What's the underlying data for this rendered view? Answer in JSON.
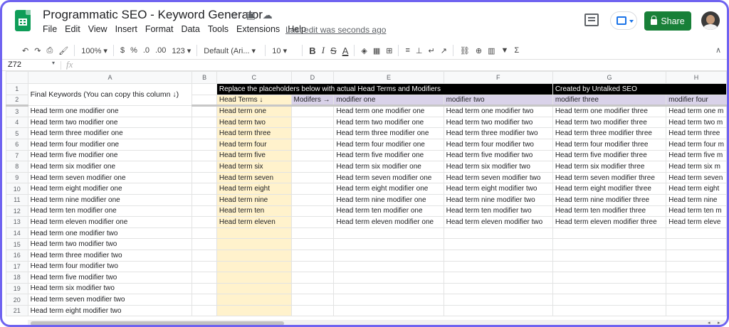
{
  "document": {
    "title": "Programmatic SEO - Keyword Generator",
    "star_icon": "☆",
    "folder_icon": "▣",
    "cloud_icon": "☁",
    "last_edit": "Last edit was seconds ago"
  },
  "menu": [
    "File",
    "Edit",
    "View",
    "Insert",
    "Format",
    "Data",
    "Tools",
    "Extensions",
    "Help"
  ],
  "header_actions": {
    "share_label": "Share",
    "share_color": "#188038",
    "present_color": "#1a73e8"
  },
  "toolbar": {
    "undo": "↶",
    "redo": "↷",
    "print": "⎙",
    "paint_format": "🖌",
    "zoom": "100%",
    "zoom_caret": "▾",
    "currency": "$",
    "percent": "%",
    "dec_decrease": ".0",
    "dec_increase": ".00",
    "more_formats": "123",
    "font": "Default (Ari...",
    "font_size": "10",
    "bold": "B",
    "italic": "I",
    "strike": "S",
    "text_color": "A",
    "fill": "◈",
    "borders": "▦",
    "merge": "⊞",
    "h_align": "≡",
    "v_align": "⊥",
    "wrap": "↵",
    "rotate": "↗",
    "link": "⛓",
    "comment": "⊕",
    "chart": "▥",
    "filter": "▼",
    "functions": "Σ",
    "collapse": "∧"
  },
  "formula_bar": {
    "name_box": "Z72",
    "fx": "fx",
    "value": ""
  },
  "columns": [
    "A",
    "B",
    "C",
    "D",
    "E",
    "F",
    "G",
    "H"
  ],
  "row1": {
    "a_merged": "Final Keywords (You can copy this column ↓)",
    "banner": "Replace the placeholders below with actual Head Terms and Modifiers",
    "credit": "Created by Untalked SEO"
  },
  "row2": {
    "head_terms": "Head Terms ↓",
    "modifiers": "Modifers →",
    "modifier_one": "modifier one",
    "modifier_two": "modifier two",
    "modifier_three": "modifier three",
    "modifier_four": "modifier four"
  },
  "rows": [
    {
      "n": "3",
      "a": "Head term one modifier one",
      "c": "Head term one",
      "e": "Head term one modifier one",
      "f": "Head term one modifier two",
      "g": "Head term one modifier three",
      "h": "Head term one m"
    },
    {
      "n": "4",
      "a": "Head term two modifier one",
      "c": "Head term two",
      "e": "Head term two modifier one",
      "f": "Head term two modifier two",
      "g": "Head term two modifier three",
      "h": "Head term two m"
    },
    {
      "n": "5",
      "a": "Head term three modifier one",
      "c": "Head term three",
      "e": "Head term three modifier one",
      "f": "Head term three modifier two",
      "g": "Head term three modifier three",
      "h": "Head term three"
    },
    {
      "n": "6",
      "a": "Head term four modifier one",
      "c": "Head term four",
      "e": "Head term four modifier one",
      "f": "Head term four modifier two",
      "g": "Head term four modifier three",
      "h": "Head term four m"
    },
    {
      "n": "7",
      "a": "Head term five modifier one",
      "c": "Head term five",
      "e": "Head term five modifier one",
      "f": "Head term five modifier two",
      "g": "Head term five modifier three",
      "h": "Head term five m"
    },
    {
      "n": "8",
      "a": "Head term six modifier one",
      "c": "Head term six",
      "e": "Head term six modifier one",
      "f": "Head term six modifier two",
      "g": "Head term six modifier three",
      "h": "Head term six m"
    },
    {
      "n": "9",
      "a": "Head term seven modifier one",
      "c": "Head term seven",
      "e": "Head term seven modifier one",
      "f": "Head term seven modifier two",
      "g": "Head term seven modifier three",
      "h": "Head term seven"
    },
    {
      "n": "10",
      "a": "Head term eight modifier one",
      "c": "Head term eight",
      "e": "Head term eight modifier one",
      "f": "Head term eight modifier two",
      "g": "Head term eight modifier three",
      "h": "Head term eight"
    },
    {
      "n": "11",
      "a": "Head term nine modifier one",
      "c": "Head term nine",
      "e": "Head term nine modifier one",
      "f": "Head term nine modifier two",
      "g": "Head term nine modifier three",
      "h": "Head term nine"
    },
    {
      "n": "12",
      "a": "Head term ten modifier one",
      "c": "Head term ten",
      "e": "Head term ten modifier one",
      "f": "Head term ten modifier two",
      "g": "Head term ten modifier three",
      "h": "Head term ten m"
    },
    {
      "n": "13",
      "a": "Head term eleven modifier one",
      "c": "Head term eleven",
      "e": "Head term eleven modifier one",
      "f": "Head term eleven modifier two",
      "g": "Head term eleven modifier three",
      "h": "Head term eleve"
    },
    {
      "n": "14",
      "a": "Head term one modifier two",
      "c": "",
      "e": "",
      "f": "",
      "g": "",
      "h": ""
    },
    {
      "n": "15",
      "a": "Head term two modifier two",
      "c": "",
      "e": "",
      "f": "",
      "g": "",
      "h": ""
    },
    {
      "n": "16",
      "a": "Head term three modifier two",
      "c": "",
      "e": "",
      "f": "",
      "g": "",
      "h": ""
    },
    {
      "n": "17",
      "a": "Head term four modifier two",
      "c": "",
      "e": "",
      "f": "",
      "g": "",
      "h": ""
    },
    {
      "n": "18",
      "a": "Head term five modifier two",
      "c": "",
      "e": "",
      "f": "",
      "g": "",
      "h": ""
    },
    {
      "n": "19",
      "a": "Head term six modifier two",
      "c": "",
      "e": "",
      "f": "",
      "g": "",
      "h": ""
    },
    {
      "n": "20",
      "a": "Head term seven modifier two",
      "c": "",
      "e": "",
      "f": "",
      "g": "",
      "h": ""
    },
    {
      "n": "21",
      "a": "Head term eight modifier two",
      "c": "",
      "e": "",
      "f": "",
      "g": "",
      "h": ""
    }
  ],
  "scrollbar": {
    "left_arrow": "◂",
    "right_arrow": "▸"
  },
  "colors": {
    "frame": "#6f63f0",
    "head_term_fill": "#fff2cc",
    "modifier_fill": "#d9d2e9",
    "banner_fill": "#000000"
  }
}
